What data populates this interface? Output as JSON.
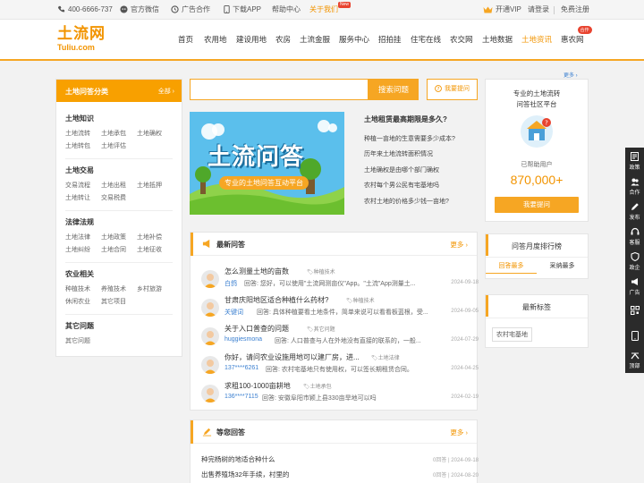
{
  "topbar": {
    "phone": "400-6666-737",
    "wechat": "官方微信",
    "ads": "广告合作",
    "app": "下载APP",
    "help": "帮助中心",
    "about": "关于我们",
    "about_badge": "New",
    "vip": "开通VIP",
    "login": "请登录",
    "register": "免费注册"
  },
  "logo": {
    "cn": "土流网",
    "en": "Tuliu.com"
  },
  "nav": {
    "items": [
      "首页",
      "农用地",
      "建设用地",
      "农房",
      "土流金服",
      "服务中心",
      "招拍挂",
      "住宅在线",
      "农交网",
      "土地数据",
      "土地资讯",
      "惠农网"
    ],
    "badge": "合作"
  },
  "category": {
    "title": "土地问答分类",
    "all": "全部",
    "groups": [
      {
        "title": "土地知识",
        "items": [
          "土地流转",
          "土地承包",
          "土地确权",
          "土地转包",
          "土地评估"
        ]
      },
      {
        "title": "土地交易",
        "items": [
          "交易流程",
          "土地出租",
          "土地抵押",
          "土地转让",
          "交易税费"
        ]
      },
      {
        "title": "法律法规",
        "items": [
          "土地法律",
          "土地政策",
          "土地补偿",
          "土地纠纷",
          "土地合同",
          "土地征收"
        ]
      },
      {
        "title": "农业相关",
        "items": [
          "种植技术",
          "养殖技术",
          "乡村旅游",
          "休闲农业",
          "其它项目"
        ]
      },
      {
        "title": "其它问题",
        "items": [
          "其它问题"
        ]
      }
    ]
  },
  "search": {
    "placeholder": "",
    "button": "搜索问题",
    "ask": "我要提问"
  },
  "banner": {
    "title": "土流问答",
    "subtitle": "专业的土地问答互动平台"
  },
  "hot": {
    "title": "土地租赁最高期限是多久?",
    "items": [
      "种植一亩地的生意需要多少成本?",
      "历年来土地流转面积情况",
      "土地确权是由哪个部门确权",
      "农村每个男公民有宅基地吗",
      "农村土地的价格多少钱一亩地?"
    ]
  },
  "latest": {
    "title": "最新问答",
    "more": "更多",
    "answer_label": "回答:",
    "rows": [
      {
        "q": "怎么测量土地的亩数",
        "tag": "种植技术",
        "user": "白鸽",
        "a": "您好，可以使用\"土流网测亩仪\"App。\"土流\"App测量土...",
        "date": "2024-09-18"
      },
      {
        "q": "甘肃庆阳地区适合种植什么药材?",
        "tag": "种植技术",
        "user": "关键词",
        "a": "具体种植要看土地条件，简单来说可以看看板蓝根，受...",
        "date": "2024-09-05"
      },
      {
        "q": "关于入口普查的问题",
        "tag": "其它问题",
        "user": "huggiesmona",
        "a": "人口普查与人在外地没有直接的联系的，一般...",
        "date": "2024-07-29"
      },
      {
        "q": "你好，请问农业设施用地可以建厂房，进...",
        "tag": "土地法律",
        "user": "137****6261",
        "a": "农村宅基地只有使用权，可以签长期租赁合同。",
        "date": "2024-04-25"
      },
      {
        "q": "求租100-1000亩耕地",
        "tag": "土地承包",
        "user": "136****7115",
        "a": "安徽阜阳市颍上县330亩旱地可以吗",
        "date": "2024-02-19"
      }
    ]
  },
  "waiting": {
    "title": "等您回答",
    "more": "更多",
    "rows": [
      {
        "q": "种完杨树的地适合种什么",
        "count": "0回答",
        "date": "2024-09-18"
      },
      {
        "q": "出售养殖场32年手续，村里的",
        "count": "0回答",
        "date": "2024-08-20"
      }
    ]
  },
  "community": {
    "more": "更多",
    "line1": "专业的土地流转",
    "line2": "问答社区平台",
    "helped_label": "已帮助用户",
    "helped_count": "870,000+",
    "button": "我要提问"
  },
  "ranking": {
    "title": "问答月度排行榜",
    "tabs": [
      "回答最多",
      "采纳最多"
    ]
  },
  "tags": {
    "title": "最新标签",
    "items": [
      "农村宅基地"
    ]
  },
  "sidebar": {
    "items": [
      "政策",
      "合作",
      "发布",
      "客服",
      "政企",
      "广告",
      "",
      ""
    ],
    "top": "顶部"
  },
  "colors": {
    "accent": "#f6a623",
    "brand": "#f29400",
    "link": "#3a7fd0",
    "sidebar": "#2b2b2b"
  }
}
